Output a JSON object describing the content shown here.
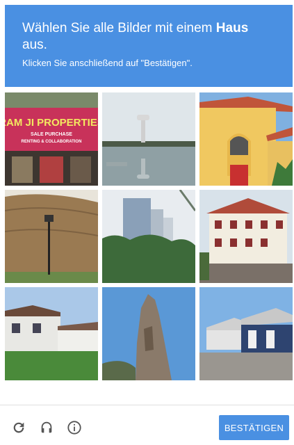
{
  "challenge": {
    "title_prefix": "Wählen Sie alle Bilder mit einem",
    "title_keyword": "Haus",
    "title_suffix": "aus.",
    "subtitle": "Klicken Sie anschließend auf \"Bestätigen\"."
  },
  "tiles": [
    {
      "subject": "shop-sign",
      "sign_text": "RAM JI PROPERTIES",
      "sign_small_1": "SALE PURCHASE",
      "sign_small_2": "RENTING & COLLABORATION"
    },
    {
      "subject": "water-tower"
    },
    {
      "subject": "arched-villa"
    },
    {
      "subject": "fortress-wall"
    },
    {
      "subject": "skyscrapers"
    },
    {
      "subject": "half-timbered-house"
    },
    {
      "subject": "suburban-house"
    },
    {
      "subject": "stone-ruin"
    },
    {
      "subject": "row-houses"
    }
  ],
  "footer": {
    "reload_icon": "reload-icon",
    "audio_icon": "headphones-icon",
    "info_icon": "info-icon",
    "verify_label": "BESTÄTIGEN"
  },
  "colors": {
    "accent": "#4a90e2"
  }
}
